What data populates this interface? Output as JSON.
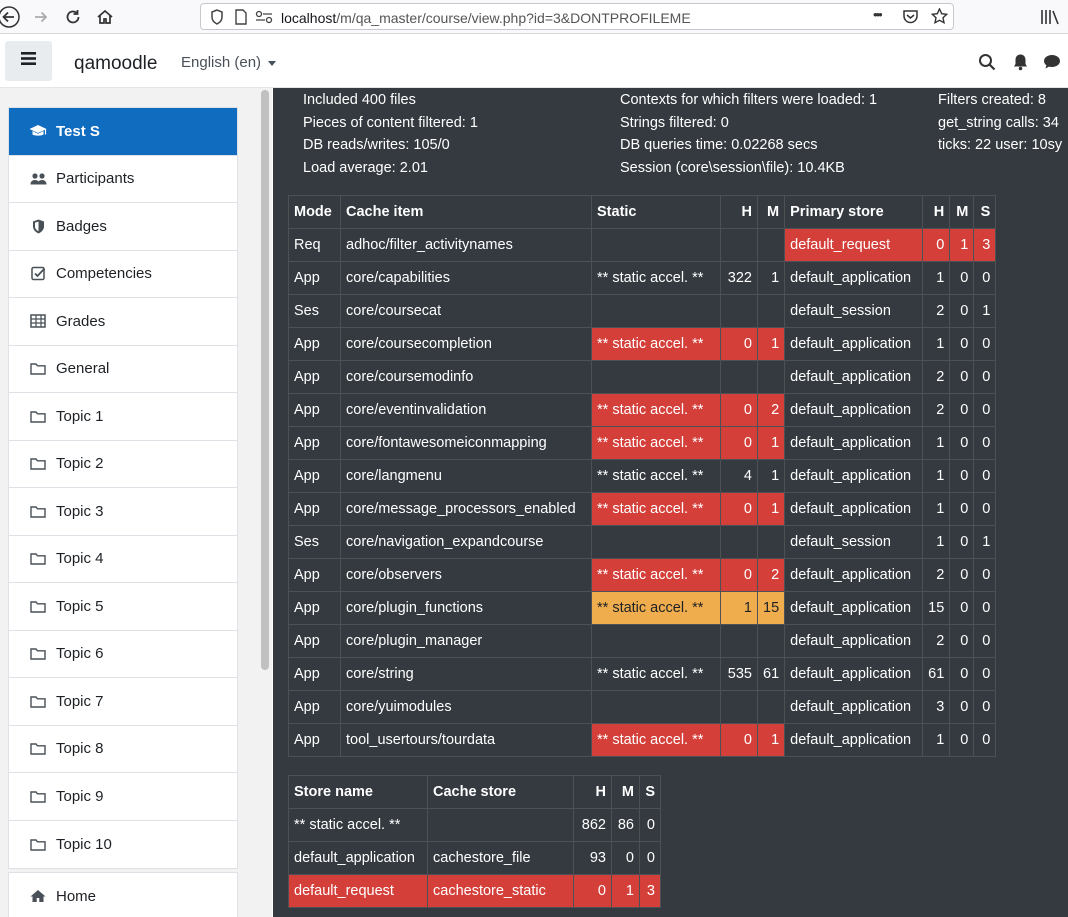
{
  "browser": {
    "url_host": "localhost",
    "url_path": "/m/qa_master/course/view.php?id=3&DONTPROFILEME",
    "more_glyph": "•••"
  },
  "navbar": {
    "brand": "qamoodle",
    "language": "English (en)"
  },
  "sidebar": {
    "items": [
      {
        "label": "Test S",
        "icon": "graduation-cap-icon",
        "active": true
      },
      {
        "label": "Participants",
        "icon": "users-icon"
      },
      {
        "label": "Badges",
        "icon": "shield-icon"
      },
      {
        "label": "Competencies",
        "icon": "check-square-icon"
      },
      {
        "label": "Grades",
        "icon": "table-icon"
      },
      {
        "label": "General",
        "icon": "folder-icon"
      },
      {
        "label": "Topic 1",
        "icon": "folder-icon"
      },
      {
        "label": "Topic 2",
        "icon": "folder-icon"
      },
      {
        "label": "Topic 3",
        "icon": "folder-icon"
      },
      {
        "label": "Topic 4",
        "icon": "folder-icon"
      },
      {
        "label": "Topic 5",
        "icon": "folder-icon"
      },
      {
        "label": "Topic 6",
        "icon": "folder-icon"
      },
      {
        "label": "Topic 7",
        "icon": "folder-icon"
      },
      {
        "label": "Topic 8",
        "icon": "folder-icon"
      },
      {
        "label": "Topic 9",
        "icon": "folder-icon"
      },
      {
        "label": "Topic 10",
        "icon": "folder-icon"
      }
    ],
    "home_label": "Home"
  },
  "stats": {
    "col1": [
      "Included 400 files",
      "Pieces of content filtered: 1",
      "DB reads/writes: 105/0",
      "Load average: 2.01"
    ],
    "col2": [
      "Contexts for which filters were loaded: 1",
      "Strings filtered: 0",
      "DB queries time: 0.02268 secs",
      "Session (core\\session\\file): 10.4KB"
    ],
    "col3": [
      "Filters created: 8",
      "get_string calls: 34",
      "ticks: 22 user: 10sy"
    ]
  },
  "cache_table": {
    "headers": [
      "Mode",
      "Cache item",
      "Static",
      "H",
      "M",
      "Primary store",
      "H",
      "M",
      "S"
    ],
    "rows": [
      {
        "mode": "Req",
        "item": "adhoc/filter_activitynames",
        "static": "",
        "sh": "",
        "sm": "",
        "store": "default_request",
        "h": "0",
        "m": "1",
        "s": "3",
        "static_color": "",
        "store_color": "red"
      },
      {
        "mode": "App",
        "item": "core/capabilities",
        "static": "** static accel. **",
        "sh": "322",
        "sm": "1",
        "store": "default_application",
        "h": "1",
        "m": "0",
        "s": "0",
        "static_color": "",
        "store_color": ""
      },
      {
        "mode": "Ses",
        "item": "core/coursecat",
        "static": "",
        "sh": "",
        "sm": "",
        "store": "default_session",
        "h": "2",
        "m": "0",
        "s": "1",
        "static_color": "",
        "store_color": ""
      },
      {
        "mode": "App",
        "item": "core/coursecompletion",
        "static": "** static accel. **",
        "sh": "0",
        "sm": "1",
        "store": "default_application",
        "h": "1",
        "m": "0",
        "s": "0",
        "static_color": "red",
        "store_color": ""
      },
      {
        "mode": "App",
        "item": "core/coursemodinfo",
        "static": "",
        "sh": "",
        "sm": "",
        "store": "default_application",
        "h": "2",
        "m": "0",
        "s": "0",
        "static_color": "",
        "store_color": ""
      },
      {
        "mode": "App",
        "item": "core/eventinvalidation",
        "static": "** static accel. **",
        "sh": "0",
        "sm": "2",
        "store": "default_application",
        "h": "2",
        "m": "0",
        "s": "0",
        "static_color": "red",
        "store_color": ""
      },
      {
        "mode": "App",
        "item": "core/fontawesomeiconmapping",
        "static": "** static accel. **",
        "sh": "0",
        "sm": "1",
        "store": "default_application",
        "h": "1",
        "m": "0",
        "s": "0",
        "static_color": "red",
        "store_color": ""
      },
      {
        "mode": "App",
        "item": "core/langmenu",
        "static": "** static accel. **",
        "sh": "4",
        "sm": "1",
        "store": "default_application",
        "h": "1",
        "m": "0",
        "s": "0",
        "static_color": "",
        "store_color": ""
      },
      {
        "mode": "App",
        "item": "core/message_processors_enabled",
        "static": "** static accel. **",
        "sh": "0",
        "sm": "1",
        "store": "default_application",
        "h": "1",
        "m": "0",
        "s": "0",
        "static_color": "red",
        "store_color": ""
      },
      {
        "mode": "Ses",
        "item": "core/navigation_expandcourse",
        "static": "",
        "sh": "",
        "sm": "",
        "store": "default_session",
        "h": "1",
        "m": "0",
        "s": "1",
        "static_color": "",
        "store_color": ""
      },
      {
        "mode": "App",
        "item": "core/observers",
        "static": "** static accel. **",
        "sh": "0",
        "sm": "2",
        "store": "default_application",
        "h": "2",
        "m": "0",
        "s": "0",
        "static_color": "red",
        "store_color": ""
      },
      {
        "mode": "App",
        "item": "core/plugin_functions",
        "static": "** static accel. **",
        "sh": "1",
        "sm": "15",
        "store": "default_application",
        "h": "15",
        "m": "0",
        "s": "0",
        "static_color": "orange",
        "store_color": ""
      },
      {
        "mode": "App",
        "item": "core/plugin_manager",
        "static": "",
        "sh": "",
        "sm": "",
        "store": "default_application",
        "h": "2",
        "m": "0",
        "s": "0",
        "static_color": "",
        "store_color": ""
      },
      {
        "mode": "App",
        "item": "core/string",
        "static": "** static accel. **",
        "sh": "535",
        "sm": "61",
        "store": "default_application",
        "h": "61",
        "m": "0",
        "s": "0",
        "static_color": "",
        "store_color": ""
      },
      {
        "mode": "App",
        "item": "core/yuimodules",
        "static": "",
        "sh": "",
        "sm": "",
        "store": "default_application",
        "h": "3",
        "m": "0",
        "s": "0",
        "static_color": "",
        "store_color": ""
      },
      {
        "mode": "App",
        "item": "tool_usertours/tourdata",
        "static": "** static accel. **",
        "sh": "0",
        "sm": "1",
        "store": "default_application",
        "h": "1",
        "m": "0",
        "s": "0",
        "static_color": "red",
        "store_color": ""
      }
    ]
  },
  "store_table": {
    "headers": [
      "Store name",
      "Cache store",
      "H",
      "M",
      "S"
    ],
    "rows": [
      {
        "name": "** static accel. **",
        "store": "",
        "h": "862",
        "m": "86",
        "s": "0",
        "color": ""
      },
      {
        "name": "default_application",
        "store": "cachestore_file",
        "h": "93",
        "m": "0",
        "s": "0",
        "color": ""
      },
      {
        "name": "default_request",
        "store": "cachestore_static",
        "h": "0",
        "m": "1",
        "s": "3",
        "color": "red"
      }
    ]
  },
  "colors": {
    "panel_bg": "#343a40",
    "miss_red": "#d43f3a",
    "warn_orange": "#f0ad4e",
    "active_blue": "#0f6cbf"
  }
}
